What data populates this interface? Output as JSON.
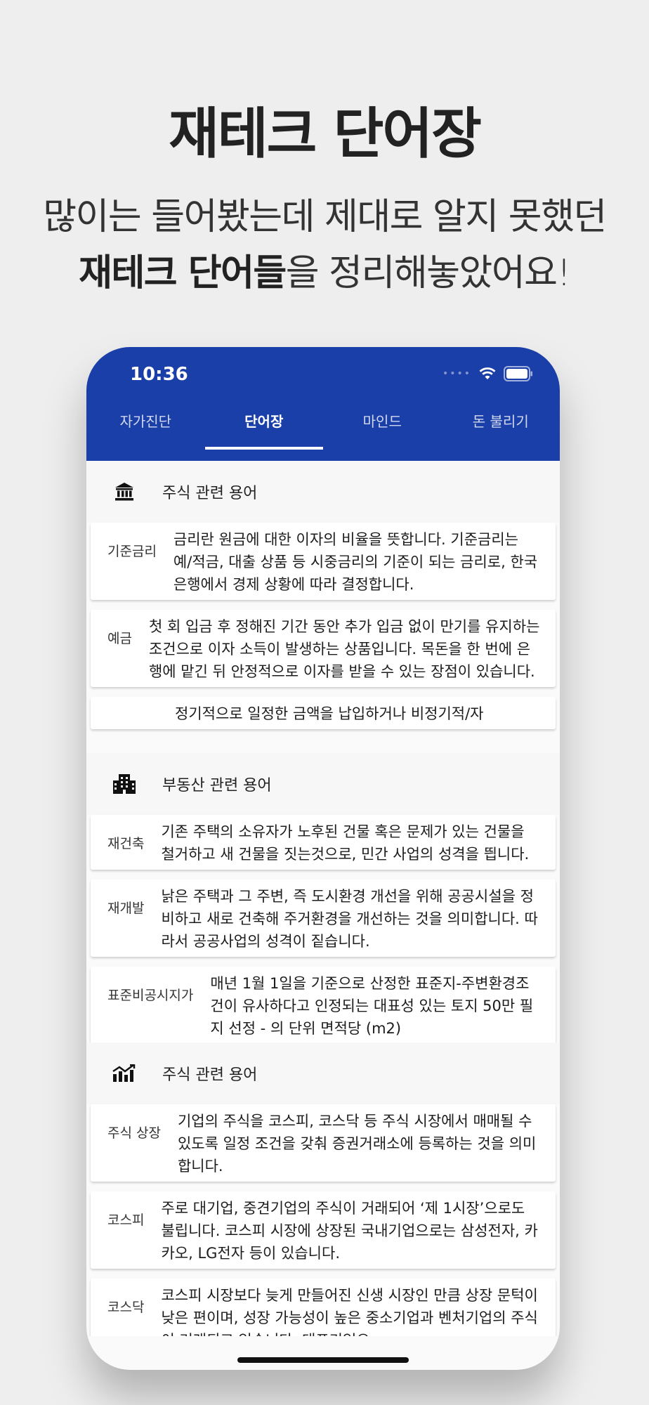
{
  "promo": {
    "title": "재테크 단어장",
    "line1": "많이는 들어봤는데 제대로 알지 못했던",
    "line2_bold": "재테크 단어들",
    "line2_rest": "을 정리해놓았어요!"
  },
  "status_bar": {
    "time": "10:36"
  },
  "tabs": [
    {
      "label": "자가진단"
    },
    {
      "label": "단어장"
    },
    {
      "label": "마인드"
    },
    {
      "label": "돈 불리기"
    }
  ],
  "colors": {
    "appbar": "#1a3fa8",
    "background": "#eeeeee"
  },
  "sections": [
    {
      "icon": "bank-icon",
      "title": "주식 관련 용어",
      "items": [
        {
          "term": "기준금리",
          "desc": "금리란 원금에 대한 이자의 비율을 뜻합니다. 기준금리는 예/적금, 대출 상품 등 시중금리의 기준이 되는 금리로, 한국은행에서 경제 상황에 따라 결정합니다."
        },
        {
          "term": "예금",
          "desc": "첫 회 입금 후 정해진 기간 동안 추가 입금 없이 만기를 유지하는 조건으로 이자 소득이 발생하는 상품입니다. 목돈을 한 번에 은행에 맡긴 뒤 안정적으로 이자를 받을 수 있는 장점이 있습니다."
        },
        {
          "term": "",
          "desc": "정기적으로 일정한 금액을 납입하거나 비정기적/자"
        }
      ]
    },
    {
      "icon": "building-icon",
      "title": "부동산 관련 용어",
      "items": [
        {
          "term": "재건축",
          "desc": "기존 주택의 소유자가 노후된 건물 혹은 문제가 있는 건물을 철거하고 새 건물을 짓는것으로, 민간 사업의 성격을 띕니다."
        },
        {
          "term": "재개발",
          "desc": "낡은 주택과 그 주변, 즉 도시환경 개선을 위해 공공시설을 정비하고 새로 건축해 주거환경을 개선하는 것을 의미합니다. 따라서 공공사업의 성격이 짙습니다."
        },
        {
          "term": "표준비공시지가",
          "desc": "매년 1월 1일을 기준으로 산정한 표준지-주변환경조건이 유사하다고 인정되는 대표성 있는 토지 50만 필지 선정 - 의 단위 면적당 (m2)"
        }
      ]
    },
    {
      "icon": "chart-icon",
      "title": "주식 관련 용어",
      "items": [
        {
          "term": "주식 상장",
          "desc": "기업의 주식을 코스피, 코스닥 등 주식 시장에서 매매될 수 있도록 일정 조건을 갖춰 증권거래소에 등록하는 것을 의미합니다."
        },
        {
          "term": "코스피",
          "desc": "주로 대기업, 중견기업의 주식이 거래되어 ‘제 1시장’으로도 불립니다. 코스피 시장에 상장된 국내기업으로는 삼성전자, 카카오, LG전자 등이 있습니다."
        },
        {
          "term": "코스닥",
          "desc": "코스피 시장보다 늦게 만들어진 신생 시장인 만큼 상장 문턱이 낮은 편이며, 성장 가능성이 높은 중소기업과 벤처기업의 주식이 거래되고 있습니다. 대표기업으"
        }
      ]
    }
  ]
}
